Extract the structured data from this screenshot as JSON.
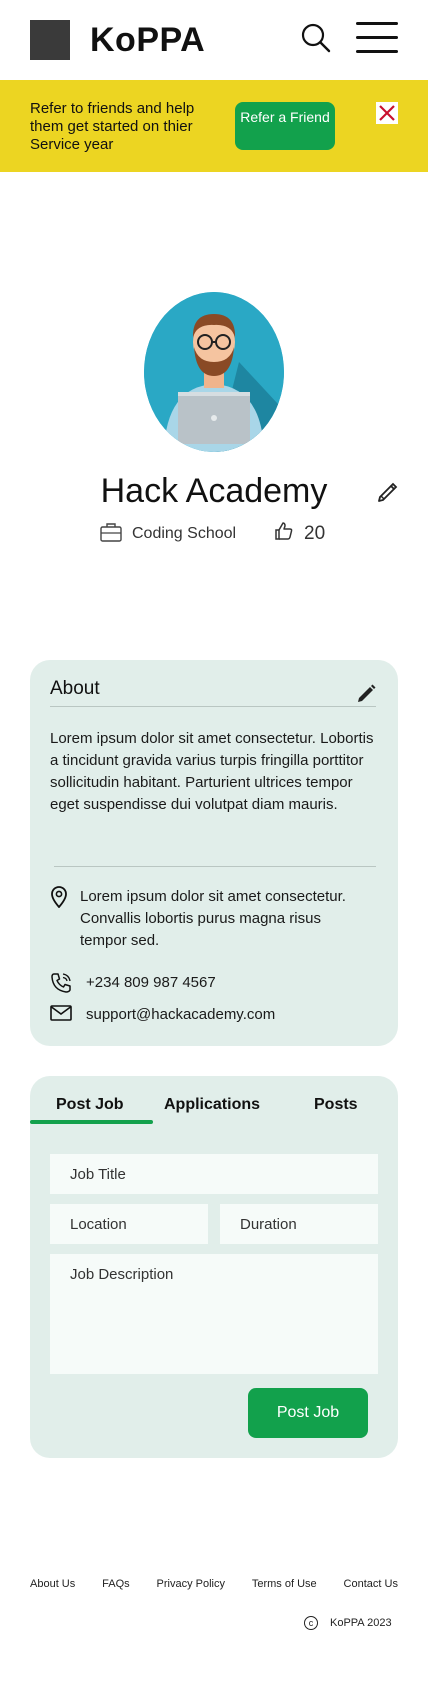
{
  "header": {
    "brand": "KoPPA",
    "icons": {
      "search": "search-icon",
      "menu": "hamburger-menu-icon"
    }
  },
  "banner": {
    "text": "Refer to friends and help them get started on thier Service year",
    "button_label": "Refer a Friend",
    "close_icon": "close-icon",
    "colors": {
      "background": "#ecd522",
      "button": "#12a14c",
      "close": "#c8102e"
    }
  },
  "profile": {
    "name": "Hack Academy",
    "category": "Coding School",
    "likes": "20",
    "icons": {
      "avatar": "avatar-illustration",
      "edit": "pencil-icon",
      "category": "briefcase-icon",
      "likes": "thumbs-up-icon"
    }
  },
  "about": {
    "heading": "About",
    "text": "Lorem ipsum dolor sit amet consectetur. Lobortis a tincidunt gravida varius turpis fringilla porttitor sollicitudin habitant. Parturient ultrices tempor eget suspendisse dui volutpat diam mauris.",
    "address": "Lorem ipsum dolor sit amet consectetur. Convallis lobortis purus magna risus tempor sed.",
    "phone": "+234 809 987 4567",
    "email": "support@hackacademy.com",
    "icons": {
      "address": "location-pin-icon",
      "phone": "phone-icon",
      "email": "mail-icon"
    }
  },
  "job_form": {
    "tabs": [
      {
        "label": "Post Job",
        "active": true
      },
      {
        "label": "Applications",
        "active": false
      },
      {
        "label": "Posts",
        "active": false
      }
    ],
    "fields": {
      "title_placeholder": "Job Title",
      "location_placeholder": "Location",
      "duration_placeholder": "Duration",
      "description_placeholder": "Job Description"
    },
    "submit_label": "Post Job"
  },
  "footer": {
    "links": [
      "About Us",
      "FAQs",
      "Privacy Policy",
      "Terms of Use",
      "Contact Us"
    ],
    "copyright": "KoPPA 2023"
  },
  "colors": {
    "accent": "#12a14c",
    "card": "#e1eeea"
  }
}
